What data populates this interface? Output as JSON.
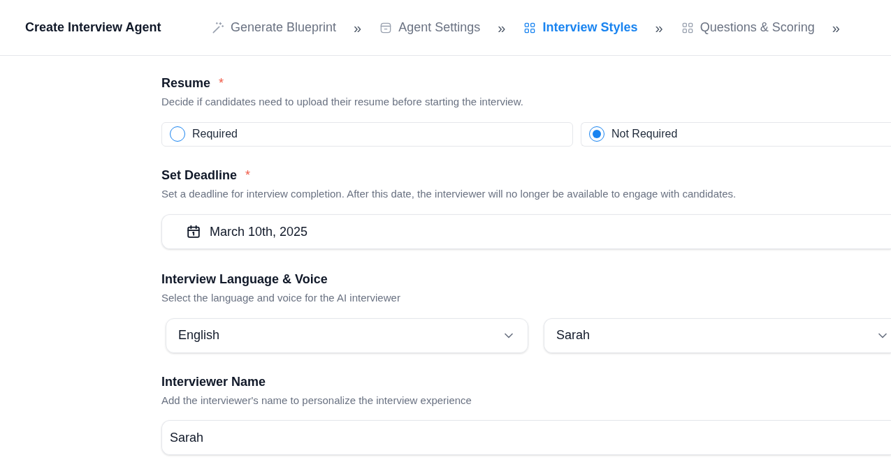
{
  "header": {
    "title": "Create Interview Agent",
    "steps": [
      {
        "label": "Generate Blueprint",
        "kind": "wand",
        "selected": false
      },
      {
        "label": "Agent Settings",
        "kind": "box",
        "selected": false
      },
      {
        "label": "Interview Styles",
        "kind": "grid",
        "selected": true
      },
      {
        "label": "Questions & Scoring",
        "kind": "grid",
        "selected": false
      }
    ],
    "separator": "»"
  },
  "resume": {
    "label": "Resume",
    "required_mark": "*",
    "description": "Decide if candidates need to upload their resume before starting the interview.",
    "options": [
      {
        "label": "Required",
        "selected": false
      },
      {
        "label": "Not Required",
        "selected": true
      }
    ]
  },
  "deadline": {
    "label": "Set Deadline",
    "required_mark": "*",
    "description": "Set a deadline for interview completion. After this date, the interviewer will no longer be available to engage with candidates.",
    "value": "March 10th, 2025"
  },
  "language_voice": {
    "label": "Interview Language & Voice",
    "description": "Select the language and voice for the AI interviewer",
    "language": "English",
    "voice": "Sarah"
  },
  "interviewer_name": {
    "label": "Interviewer Name",
    "description": "Add the interviewer's name to personalize the interview experience",
    "value": "Sarah"
  }
}
